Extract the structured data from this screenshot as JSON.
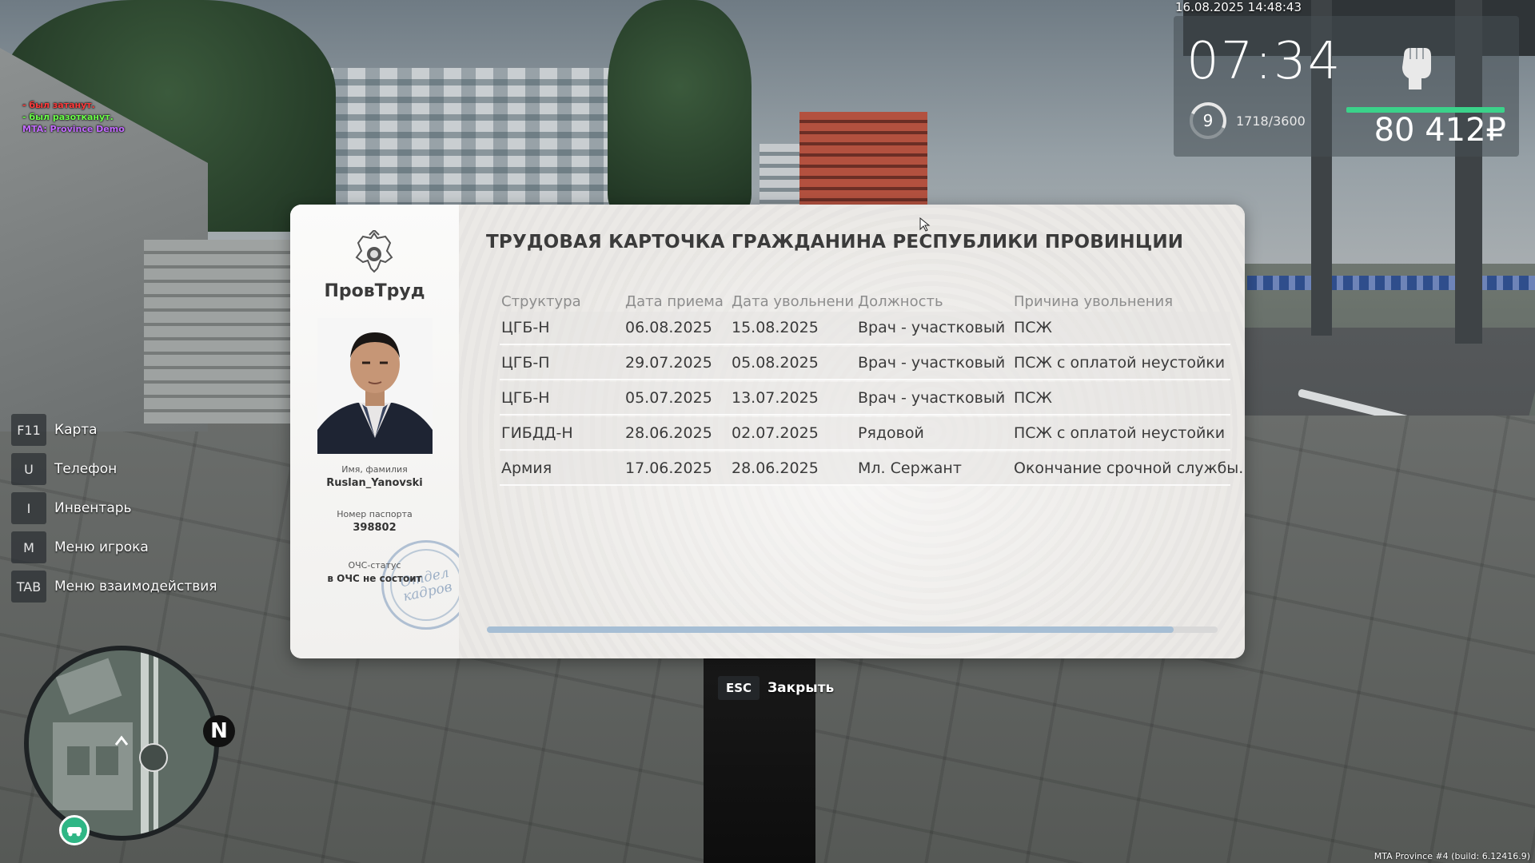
{
  "hud": {
    "datetime": "16.08.2025 14:48:43",
    "time": "07:34",
    "level": "9",
    "xp": "1718/3600",
    "money": "80 412₽",
    "health_fraction": 1.0,
    "health_color": "#3bd28a"
  },
  "chat": [
    {
      "text": "- был затанут.",
      "color": "#ff3b3b"
    },
    {
      "text": "- был разотканут.",
      "color": "#6bff4a"
    },
    {
      "text": "MTA: Province Demo",
      "color": "#c36bff"
    }
  ],
  "hints": [
    {
      "key": "F11",
      "label": "Карта"
    },
    {
      "key": "U",
      "label": "Телефон"
    },
    {
      "key": "I",
      "label": "Инвентарь"
    },
    {
      "key": "M",
      "label": "Меню игрока"
    },
    {
      "key": "TAB",
      "label": "Меню взаимодействия"
    }
  ],
  "minimap": {
    "north": "N"
  },
  "card": {
    "org": "ПровТруд",
    "title": "ТРУДОВАЯ КАРТОЧКА ГРАЖДАНИНА РЕСПУБЛИКИ ПРОВИНЦИИ",
    "name_label": "Имя, фамилия",
    "name_value": "Ruslan_Yanovski",
    "passport_label": "Номер паспорта",
    "passport_value": "398802",
    "ochs_label": "ОЧС-статус",
    "ochs_value": "в ОЧС не состоит",
    "stamp_line1": "Отдел",
    "stamp_line2": "кадров",
    "columns": [
      "Структура",
      "Дата приема",
      "Дата увольнени",
      "Должность",
      "Причина увольнения"
    ],
    "rows": [
      [
        "ЦГБ-Н",
        "06.08.2025",
        "15.08.2025",
        "Врач - участковый",
        "ПСЖ"
      ],
      [
        "ЦГБ-П",
        "29.07.2025",
        "05.08.2025",
        "Врач - участковый",
        "ПСЖ с оплатой неустойки"
      ],
      [
        "ЦГБ-Н",
        "05.07.2025",
        "13.07.2025",
        "Врач - участковый",
        "ПСЖ"
      ],
      [
        "ГИБДД-Н",
        "28.06.2025",
        "02.07.2025",
        "Рядовой",
        "ПСЖ с оплатой неустойки"
      ],
      [
        "Армия",
        "17.06.2025",
        "28.06.2025",
        "Мл. Сержант",
        "Окончание срочной службы."
      ]
    ],
    "scroll_fraction": 0.94,
    "scroll_color": "#a6bed4",
    "stamp_color": "#7896b9"
  },
  "close": {
    "key": "ESC",
    "label": "Закрыть"
  },
  "build": "MTA Province #4 (build: 6.12416.9)"
}
